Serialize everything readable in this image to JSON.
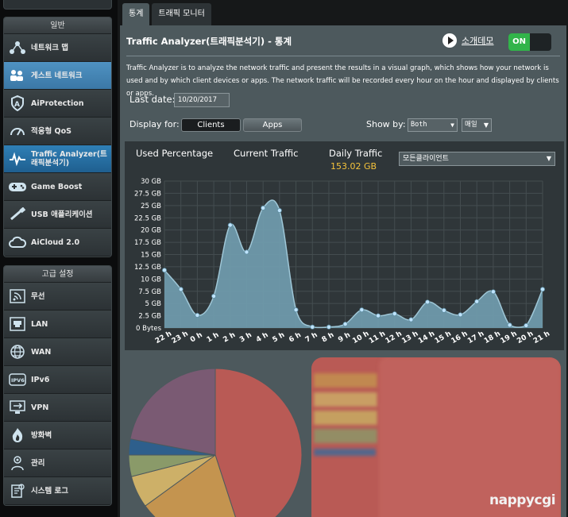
{
  "sidebar": {
    "general_header": "일반",
    "general_items": [
      {
        "label": "네트워크 맵",
        "icon": "network-map-icon",
        "state": "normal"
      },
      {
        "label": "게스트 네트워크",
        "icon": "guest-network-icon",
        "state": "blue"
      },
      {
        "label": "AiProtection",
        "icon": "aiprotection-icon",
        "state": "normal"
      },
      {
        "label": "적응형 QoS",
        "icon": "qos-gauge-icon",
        "state": "normal"
      },
      {
        "label": "Traffic Analyzer(트래픽분석기)",
        "icon": "traffic-analyzer-icon",
        "state": "active"
      },
      {
        "label": "Game Boost",
        "icon": "gamepad-icon",
        "state": "normal"
      },
      {
        "label": "USB 애플리케이션",
        "icon": "usb-icon",
        "state": "normal"
      },
      {
        "label": "AiCloud 2.0",
        "icon": "cloud-icon",
        "state": "normal"
      }
    ],
    "advanced_header": "고급 설정",
    "advanced_items": [
      {
        "label": "무선",
        "icon": "wireless-icon"
      },
      {
        "label": "LAN",
        "icon": "lan-icon"
      },
      {
        "label": "WAN",
        "icon": "wan-globe-icon"
      },
      {
        "label": "IPv6",
        "icon": "ipv6-icon"
      },
      {
        "label": "VPN",
        "icon": "vpn-icon"
      },
      {
        "label": "방화벽",
        "icon": "firewall-icon"
      },
      {
        "label": "관리",
        "icon": "admin-icon"
      },
      {
        "label": "시스템 로그",
        "icon": "system-log-icon"
      }
    ]
  },
  "tabs": [
    {
      "label": "통계",
      "active": true
    },
    {
      "label": "트래픽 모니터",
      "active": false
    }
  ],
  "header": {
    "title": "Traffic Analyzer(트래픽분석기) - 통계",
    "demo_label": "소개데모",
    "toggle_label": "ON",
    "toggle_color": "#32b44a"
  },
  "description": "Traffic Analyzer is to analyze the network traffic and present the results in a visual graph, which shows how your network is used and by which client devices or apps. The network traffic will be recorded every hour on the hour and displayed by clients or apps.",
  "controls": {
    "last_date_label": "Last date:",
    "last_date_value": "10/20/2017",
    "display_for_label": "Display for:",
    "display_options": [
      "Clients",
      "Apps"
    ],
    "display_selected": "Clients",
    "show_by_label": "Show by:",
    "show_by_value": "Both",
    "period_value": "매일",
    "client_filter": "모든클라이언트"
  },
  "stats": {
    "used_percentage_label": "Used Percentage",
    "current_traffic_label": "Current Traffic",
    "daily_traffic_label": "Daily Traffic",
    "daily_traffic_value": "153.02 GB",
    "daily_traffic_color": "#f5c33b"
  },
  "chart_data": {
    "type": "area",
    "x": [
      "22 h",
      "23 h",
      "0 h",
      "1 h",
      "2 h",
      "3 h",
      "4 h",
      "5 h",
      "6 h",
      "7 h",
      "8 h",
      "9 h",
      "10 h",
      "11 h",
      "12 h",
      "13 h",
      "14 h",
      "15 h",
      "16 h",
      "17 h",
      "18 h",
      "19 h",
      "20 h",
      "21 h"
    ],
    "series": [
      {
        "values": [
          11.8,
          7.9,
          2.6,
          6.5,
          21.0,
          15.5,
          24.5,
          24.0,
          3.7,
          0.2,
          0.2,
          0.8,
          3.7,
          2.5,
          2.9,
          1.7,
          5.3,
          3.6,
          2.7,
          5.4,
          7.4,
          0.6,
          0.5,
          7.9
        ]
      }
    ],
    "y_ticks": [
      "0 Bytes",
      "2.5 GB",
      "5 GB",
      "7.5 GB",
      "10 GB",
      "12.5 GB",
      "15 GB",
      "17.5 GB",
      "20 GB",
      "22.5 GB",
      "25 GB",
      "27.5 GB",
      "30 GB"
    ],
    "ylim": [
      0,
      30
    ],
    "grid": true,
    "fill_color": "#6f9aab",
    "line_color": "#9ec6d6",
    "point_color": "#bfe4ff"
  },
  "pie": {
    "slices": [
      {
        "value": 45,
        "color": "#b95a55"
      },
      {
        "value": 20,
        "color": "#c4944f"
      },
      {
        "value": 6,
        "color": "#cdb068"
      },
      {
        "value": 4,
        "color": "#8a9a69"
      },
      {
        "value": 3,
        "color": "#2e5f8c"
      },
      {
        "value": 22,
        "color": "#7a5a73"
      }
    ],
    "legend_colors": [
      "#c4944f",
      "#cdb068",
      "#c9b163",
      "#8a9a69",
      "#3a6a9a"
    ]
  },
  "watermark": "nappycgi"
}
